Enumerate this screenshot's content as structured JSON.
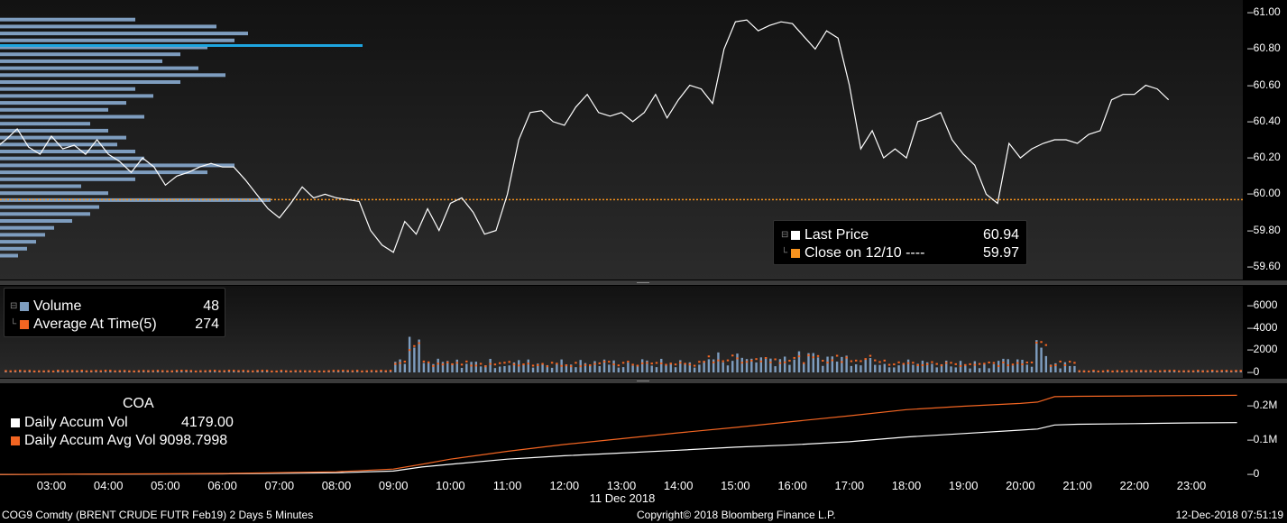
{
  "price_panel": {
    "y_ticks": [
      "61.00",
      "60.80",
      "60.60",
      "60.40",
      "60.20",
      "60.00",
      "59.80",
      "59.60"
    ],
    "legend": {
      "last_price_label": "Last Price",
      "last_price_value": "60.94",
      "close_label": "Close on 12/10 ----",
      "close_value": "59.97"
    },
    "colors": {
      "line": "#ffffff",
      "close_line": "#f7931e",
      "profile": "#7e9dbf",
      "profile_highlight": "#1ea5e0"
    }
  },
  "volume_panel": {
    "y_ticks": [
      "6000",
      "4000",
      "2000",
      "0"
    ],
    "legend": {
      "volume_label": "Volume",
      "volume_value": "48",
      "avg_label": "Average At Time(5)",
      "avg_value": "274"
    },
    "colors": {
      "bars": "#7e9dbf",
      "avg": "#f26522"
    }
  },
  "accum_panel": {
    "y_ticks": [
      "0.2M",
      "0.1M",
      "0"
    ],
    "legend": {
      "title": "COA",
      "daily_label": "Daily Accum Vol",
      "daily_value": "4179.00",
      "avg_label": "Daily Accum Avg Vol",
      "avg_value": "9098.7998"
    },
    "colors": {
      "daily": "#ffffff",
      "avg": "#f26522"
    }
  },
  "x_axis": {
    "ticks": [
      "03:00",
      "04:00",
      "05:00",
      "06:00",
      "07:00",
      "08:00",
      "09:00",
      "10:00",
      "11:00",
      "12:00",
      "13:00",
      "14:00",
      "15:00",
      "16:00",
      "17:00",
      "18:00",
      "19:00",
      "20:00",
      "21:00",
      "22:00",
      "23:00"
    ],
    "date_label": "11 Dec 2018"
  },
  "footer": {
    "left": "COG9 Comdty (BRENT CRUDE FUTR  Feb19) 2 Days 5 Minutes",
    "center": "Copyright© 2018 Bloomberg Finance L.P.",
    "right": "12-Dec-2018 07:51:19"
  },
  "chart_data": [
    {
      "type": "line",
      "series": [
        {
          "name": "Last Price",
          "x_hours": [
            2.0,
            2.2,
            2.4,
            2.6,
            2.8,
            3.0,
            3.2,
            3.4,
            3.6,
            3.8,
            4.0,
            4.2,
            4.4,
            4.6,
            4.8,
            5.0,
            5.2,
            5.4,
            5.6,
            5.8,
            6.0,
            6.2,
            6.4,
            6.6,
            6.8,
            7.0,
            7.2,
            7.4,
            7.6,
            7.8,
            8.0,
            8.2,
            8.4,
            8.6,
            8.8,
            9.0,
            9.2,
            9.4,
            9.6,
            9.8,
            10.0,
            10.2,
            10.4,
            10.6,
            10.8,
            11.0,
            11.2,
            11.4,
            11.6,
            11.8,
            12.0,
            12.2,
            12.4,
            12.6,
            12.8,
            13.0,
            13.2,
            13.4,
            13.6,
            13.8,
            14.0,
            14.2,
            14.4,
            14.6,
            14.8,
            15.0,
            15.2,
            15.4,
            15.6,
            15.8,
            16.0,
            16.2,
            16.4,
            16.6,
            16.8,
            17.0,
            17.2,
            17.4,
            17.6,
            17.8,
            18.0,
            18.2,
            18.4,
            18.6,
            18.8,
            19.0,
            19.2,
            19.4,
            19.6,
            19.8,
            20.0,
            20.2,
            20.4,
            20.6,
            20.8,
            21.0,
            21.2,
            21.4,
            21.6,
            21.8,
            22.0,
            22.2,
            22.4,
            22.6,
            22.8,
            23.0,
            23.2,
            23.4,
            23.6,
            23.8
          ],
          "values": [
            60.25,
            60.3,
            60.36,
            60.26,
            60.22,
            60.32,
            60.25,
            60.27,
            60.22,
            60.3,
            60.22,
            60.18,
            60.12,
            60.2,
            60.15,
            60.05,
            60.1,
            60.12,
            60.15,
            60.17,
            60.15,
            60.15,
            60.08,
            60.0,
            59.92,
            59.87,
            59.95,
            60.04,
            59.98,
            60.0,
            59.98,
            59.97,
            59.96,
            59.8,
            59.72,
            59.68,
            59.85,
            59.78,
            59.92,
            59.8,
            59.95,
            59.98,
            59.9,
            59.78,
            59.8,
            60.0,
            60.3,
            60.45,
            60.46,
            60.4,
            60.38,
            60.48,
            60.55,
            60.45,
            60.43,
            60.45,
            60.4,
            60.45,
            60.55,
            60.42,
            60.52,
            60.6,
            60.58,
            60.5,
            60.8,
            60.95,
            60.96,
            60.9,
            60.93,
            60.95,
            60.94,
            60.87,
            60.8,
            60.9,
            60.86,
            60.6,
            60.25,
            60.35,
            60.2,
            60.25,
            60.2,
            60.4,
            60.42,
            60.45,
            60.3,
            60.22,
            60.16,
            60.0,
            59.95,
            60.28,
            60.2,
            60.25,
            60.28,
            60.3,
            60.3,
            60.28,
            60.33,
            60.35,
            60.52,
            60.55,
            60.55,
            60.6,
            60.58,
            60.52
          ]
        }
      ],
      "ylim": [
        59.53,
        61.07
      ]
    },
    {
      "type": "bar",
      "series": [
        {
          "name": "Volume"
        },
        {
          "name": "Average At Time(5)"
        }
      ],
      "ylim": [
        0,
        7000
      ]
    },
    {
      "type": "line",
      "series": [
        {
          "name": "Daily Accum Vol",
          "x_hours": [
            2.0,
            6.0,
            8.0,
            9.0,
            9.5,
            10.0,
            11.0,
            12.0,
            13.0,
            14.0,
            15.0,
            16.0,
            17.0,
            18.0,
            19.0,
            20.0,
            20.3,
            20.6,
            21.0,
            22.0,
            23.0,
            23.8
          ],
          "values": [
            0,
            2000,
            5000,
            10000,
            22000,
            30000,
            45000,
            55000,
            63000,
            71000,
            80000,
            87000,
            96000,
            110000,
            120000,
            130000,
            133000,
            145000,
            147000,
            149000,
            151000,
            152000
          ]
        },
        {
          "name": "Daily Accum Avg Vol",
          "x_hours": [
            2.0,
            6.0,
            8.0,
            9.0,
            9.5,
            10.0,
            11.0,
            12.0,
            13.0,
            14.0,
            15.0,
            16.0,
            17.0,
            18.0,
            19.0,
            20.0,
            20.3,
            20.6,
            21.0,
            22.0,
            23.0,
            23.8
          ],
          "values": [
            0,
            3000,
            8000,
            16000,
            30000,
            45000,
            68000,
            88000,
            105000,
            122000,
            138000,
            155000,
            172000,
            190000,
            200000,
            208000,
            212000,
            228000,
            229000,
            230000,
            231000,
            232000
          ]
        }
      ],
      "ylim": [
        -10000,
        262000
      ]
    }
  ]
}
